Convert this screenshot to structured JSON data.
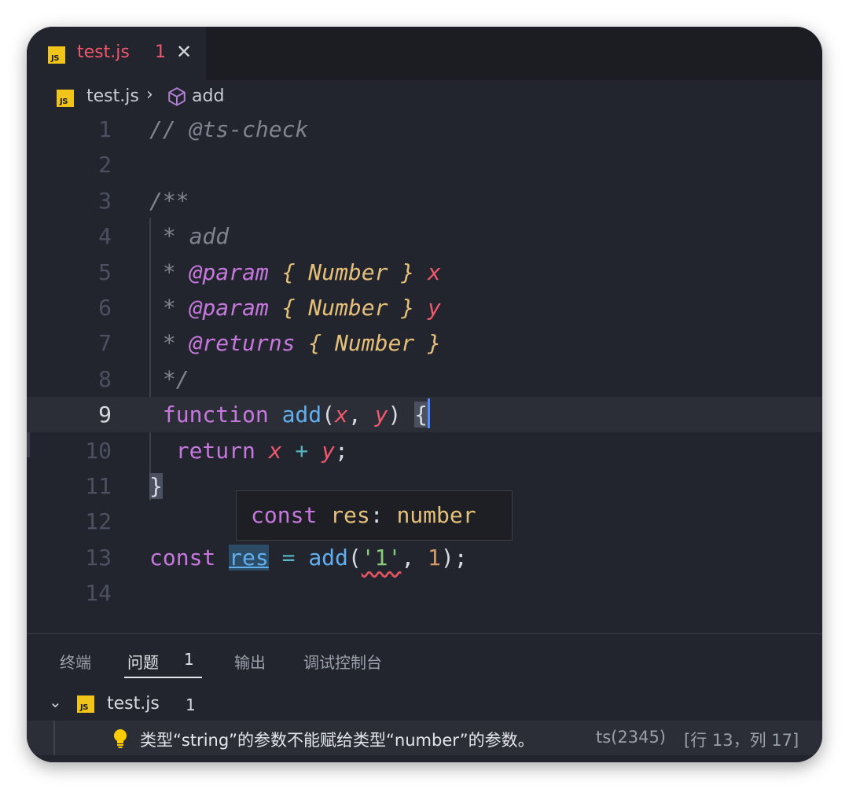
{
  "tab": {
    "badge": "JS",
    "title": "test.js",
    "problem_count": "1",
    "close_glyph": "✕"
  },
  "breadcrumb": {
    "badge": "JS",
    "file": "test.js",
    "separator": "›",
    "symbol": "add",
    "symbol_icon": "cube-icon"
  },
  "editor": {
    "lines": [
      {
        "n": "1",
        "t": [
          {
            "c": "cm",
            "s": "// @ts-check"
          }
        ]
      },
      {
        "n": "2",
        "t": []
      },
      {
        "n": "3",
        "t": [
          {
            "c": "cm",
            "s": "/**"
          }
        ]
      },
      {
        "n": "4",
        "t": [
          {
            "c": "cm",
            "s": " * add"
          }
        ]
      },
      {
        "n": "5",
        "t": [
          {
            "c": "cm",
            "s": " * "
          },
          {
            "c": "kw i",
            "s": "@param"
          },
          {
            "c": "ty",
            "s": " { Number } "
          },
          {
            "c": "pr",
            "s": "x"
          }
        ]
      },
      {
        "n": "6",
        "t": [
          {
            "c": "cm",
            "s": " * "
          },
          {
            "c": "kw i",
            "s": "@param"
          },
          {
            "c": "ty",
            "s": " { Number } "
          },
          {
            "c": "pr",
            "s": "y"
          }
        ]
      },
      {
        "n": "7",
        "t": [
          {
            "c": "cm",
            "s": " * "
          },
          {
            "c": "kw i",
            "s": "@returns"
          },
          {
            "c": "ty",
            "s": " { Number }"
          }
        ]
      },
      {
        "n": "8",
        "t": [
          {
            "c": "cm",
            "s": " */"
          }
        ]
      },
      {
        "n": "9",
        "active": true,
        "t": [
          {
            "c": "kw",
            "s": " function "
          },
          {
            "c": "fn",
            "s": "add"
          },
          {
            "c": "pu",
            "s": "("
          },
          {
            "c": "pr",
            "s": "x"
          },
          {
            "c": "pu",
            "s": ", "
          },
          {
            "c": "pr",
            "s": "y"
          },
          {
            "c": "pu",
            "s": ") "
          },
          {
            "c": "pu brace-hl",
            "s": "{"
          },
          {
            "c": "cursor",
            "s": ""
          }
        ]
      },
      {
        "n": "10",
        "t": [
          {
            "c": "kw",
            "s": "  return "
          },
          {
            "c": "pr",
            "s": "x"
          },
          {
            "c": "op",
            "s": " + "
          },
          {
            "c": "pr",
            "s": "y"
          },
          {
            "c": "pu",
            "s": ";"
          }
        ]
      },
      {
        "n": "11",
        "t": [
          {
            "c": "pu brace-hl",
            "s": "}"
          }
        ]
      },
      {
        "n": "12",
        "t": []
      },
      {
        "n": "13",
        "t": [
          {
            "c": "kw",
            "s": "const "
          },
          {
            "c": "fn res-word",
            "s": "res"
          },
          {
            "c": "op",
            "s": " = "
          },
          {
            "c": "fn",
            "s": "add"
          },
          {
            "c": "pu",
            "s": "("
          },
          {
            "c": "str squiggle",
            "s": "'1'"
          },
          {
            "c": "pu",
            "s": ", "
          },
          {
            "c": "num",
            "s": "1"
          },
          {
            "c": "pu",
            "s": ");"
          }
        ]
      },
      {
        "n": "14",
        "t": []
      }
    ]
  },
  "hover": {
    "keyword": "const",
    "name": " res",
    "sep": ":",
    "type": " number"
  },
  "panel": {
    "tabs": [
      "终端",
      "问题",
      "输出",
      "调试控制台"
    ],
    "active_tab": "问题",
    "problem_badge": "1",
    "file": {
      "chevron": "⌄",
      "badge": "JS",
      "name": "test.js",
      "count": "1"
    },
    "problem": {
      "icon": "lightbulb-icon",
      "message": "类型“string”的参数不能赋给类型“number”的参数。",
      "code": "ts(2345)",
      "location": "[行 13，列 17]"
    }
  },
  "colors": {
    "editor_bg": "#22252d",
    "tabbar_bg": "#1b1d23",
    "error": "#f0566b",
    "keyword": "#c678dd",
    "function": "#61afef",
    "param": "#ef596f",
    "type": "#e5c07b",
    "string": "#89ca78",
    "number": "#d19a66",
    "js_badge": "#f0c419"
  }
}
